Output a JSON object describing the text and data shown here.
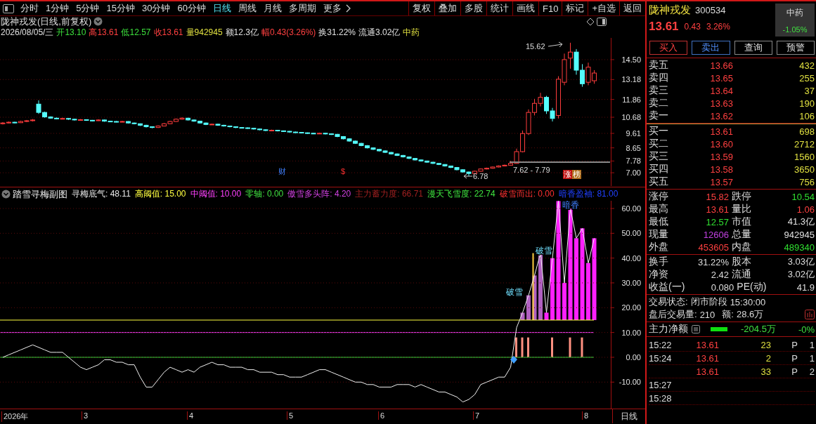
{
  "toolbar": {
    "periods": [
      {
        "label": "分时",
        "selected": false
      },
      {
        "label": "1分钟",
        "selected": false
      },
      {
        "label": "5分钟",
        "selected": false
      },
      {
        "label": "15分钟",
        "selected": false
      },
      {
        "label": "30分钟",
        "selected": false
      },
      {
        "label": "60分钟",
        "selected": false
      },
      {
        "label": "日线",
        "selected": true
      },
      {
        "label": "周线",
        "selected": false
      },
      {
        "label": "月线",
        "selected": false
      },
      {
        "label": "多周期",
        "selected": false
      },
      {
        "label": "更多",
        "selected": false
      }
    ],
    "tools": [
      "复权",
      "叠加",
      "多股",
      "统计",
      "画线",
      "F10",
      "标记",
      "+自选",
      "返回"
    ]
  },
  "main_chart": {
    "title": "陇神戎发(日线,前复权)",
    "info": [
      {
        "text": "2026/08/05/三",
        "color": "#e0e0e0"
      },
      {
        "text": "开13.10",
        "color": "#3ce03c"
      },
      {
        "text": "高13.61",
        "color": "#ff4040"
      },
      {
        "text": "低12.57",
        "color": "#3ce03c"
      },
      {
        "text": "收13.61",
        "color": "#ff4040"
      },
      {
        "text": "量942945",
        "color": "#e0e040"
      },
      {
        "text": "额12.3亿",
        "color": "#e0e0e0"
      },
      {
        "text": "幅0.43(3.26%)",
        "color": "#ff4040"
      },
      {
        "text": "换31.22%",
        "color": "#e0e0e0"
      },
      {
        "text": "流通3.02亿",
        "color": "#e0e0e0"
      },
      {
        "text": "中药",
        "color": "#e0e040"
      }
    ],
    "chart_data": {
      "type": "candlestick",
      "grid": true,
      "ylim": [
        6.12,
        15.94
      ],
      "yticks": [
        {
          "value": 14.5,
          "label": "14.50"
        },
        {
          "value": 13.18,
          "label": "13.18"
        },
        {
          "value": 11.86,
          "label": "11.86"
        },
        {
          "value": 10.68,
          "label": "10.68"
        },
        {
          "value": 9.61,
          "label": "9.61"
        },
        {
          "value": 8.65,
          "label": "8.65"
        },
        {
          "value": 7.78,
          "label": "7.78"
        },
        {
          "value": 7,
          "label": "7.00"
        }
      ],
      "ohlc": [
        [
          10.25,
          10.36,
          10.2,
          10.3
        ],
        [
          10.3,
          10.4,
          10.26,
          10.35
        ],
        [
          10.35,
          10.38,
          10.28,
          10.32
        ],
        [
          10.32,
          10.45,
          10.3,
          10.4
        ],
        [
          10.4,
          10.5,
          10.36,
          10.45
        ],
        [
          10.45,
          10.56,
          10.4,
          10.5
        ],
        [
          11.55,
          11.8,
          10.9,
          11.0
        ],
        [
          11.0,
          11.05,
          10.65,
          10.7
        ],
        [
          10.7,
          10.74,
          10.58,
          10.62
        ],
        [
          10.62,
          10.66,
          10.54,
          10.58
        ],
        [
          10.58,
          10.65,
          10.55,
          10.6
        ],
        [
          10.6,
          10.63,
          10.5,
          10.55
        ],
        [
          10.55,
          10.58,
          10.46,
          10.5
        ],
        [
          10.5,
          10.56,
          10.47,
          10.52
        ],
        [
          10.52,
          10.54,
          10.44,
          10.48
        ],
        [
          10.48,
          10.5,
          10.41,
          10.45
        ],
        [
          10.45,
          10.55,
          10.43,
          10.5
        ],
        [
          10.5,
          10.52,
          10.38,
          10.42
        ],
        [
          10.42,
          10.45,
          10.36,
          10.4
        ],
        [
          10.4,
          10.43,
          10.34,
          10.38
        ],
        [
          10.38,
          10.44,
          10.35,
          10.4
        ],
        [
          10.4,
          10.42,
          10.26,
          10.3
        ],
        [
          10.3,
          10.33,
          10.21,
          10.25
        ],
        [
          10.25,
          10.27,
          10.1,
          10.15
        ],
        [
          10.15,
          10.18,
          10.0,
          10.05
        ],
        [
          10.05,
          10.08,
          9.95,
          10.0
        ],
        [
          10.0,
          10.14,
          9.97,
          10.1
        ],
        [
          10.1,
          10.3,
          10.08,
          10.25
        ],
        [
          10.25,
          10.44,
          10.22,
          10.4
        ],
        [
          10.4,
          10.6,
          10.38,
          10.55
        ],
        [
          10.55,
          10.68,
          10.52,
          10.62
        ],
        [
          10.62,
          10.65,
          10.46,
          10.5
        ],
        [
          10.5,
          10.53,
          10.38,
          10.42
        ],
        [
          10.42,
          10.45,
          10.26,
          10.3
        ],
        [
          10.3,
          10.33,
          10.16,
          10.2
        ],
        [
          10.2,
          10.26,
          10.17,
          10.22
        ],
        [
          10.22,
          10.24,
          10.11,
          10.15
        ],
        [
          10.15,
          10.18,
          10.06,
          10.1
        ],
        [
          10.1,
          10.12,
          10.01,
          10.05
        ],
        [
          10.05,
          10.08,
          9.96,
          10.0
        ],
        [
          10.0,
          10.03,
          9.94,
          9.98
        ],
        [
          9.98,
          10.01,
          9.91,
          9.95
        ],
        [
          9.95,
          9.97,
          9.86,
          9.9
        ],
        [
          9.9,
          9.93,
          9.81,
          9.85
        ],
        [
          9.85,
          9.88,
          9.76,
          9.8
        ],
        [
          9.8,
          9.86,
          9.78,
          9.82
        ],
        [
          9.82,
          9.84,
          9.74,
          9.78
        ],
        [
          9.78,
          9.8,
          9.71,
          9.75
        ],
        [
          9.75,
          9.77,
          9.66,
          9.7
        ],
        [
          9.7,
          9.73,
          9.64,
          9.68
        ],
        [
          9.68,
          9.7,
          9.61,
          9.65
        ],
        [
          9.65,
          9.67,
          9.58,
          9.62
        ],
        [
          9.62,
          9.64,
          9.56,
          9.6
        ],
        [
          9.6,
          9.66,
          9.58,
          9.62
        ],
        [
          9.62,
          9.64,
          9.54,
          9.58
        ],
        [
          9.58,
          9.6,
          9.51,
          9.55
        ],
        [
          9.55,
          9.57,
          9.36,
          9.4
        ],
        [
          9.4,
          9.43,
          9.21,
          9.25
        ],
        [
          9.25,
          9.28,
          9.06,
          9.1
        ],
        [
          9.1,
          9.13,
          8.91,
          8.95
        ],
        [
          8.95,
          8.98,
          8.76,
          8.8
        ],
        [
          8.8,
          8.83,
          8.61,
          8.65
        ],
        [
          8.65,
          8.68,
          8.51,
          8.55
        ],
        [
          8.55,
          8.58,
          8.41,
          8.45
        ],
        [
          8.45,
          8.48,
          8.31,
          8.35
        ],
        [
          8.35,
          8.38,
          8.21,
          8.25
        ],
        [
          8.25,
          8.28,
          8.11,
          8.15
        ],
        [
          8.15,
          8.18,
          8.01,
          8.05
        ],
        [
          8.05,
          8.08,
          7.91,
          7.95
        ],
        [
          7.95,
          7.98,
          7.81,
          7.85
        ],
        [
          7.85,
          7.88,
          7.74,
          7.78
        ],
        [
          7.78,
          7.8,
          7.66,
          7.7
        ],
        [
          7.7,
          7.72,
          7.58,
          7.62
        ],
        [
          7.62,
          7.64,
          7.51,
          7.55
        ],
        [
          7.55,
          7.57,
          7.41,
          7.45
        ],
        [
          7.45,
          7.47,
          7.31,
          7.35
        ],
        [
          7.35,
          7.38,
          7.16,
          7.2
        ],
        [
          7.2,
          7.23,
          7.01,
          7.05
        ],
        [
          7.05,
          7.08,
          6.78,
          6.95
        ],
        [
          6.95,
          7.14,
          6.92,
          7.1
        ],
        [
          7.1,
          7.29,
          7.07,
          7.25
        ],
        [
          7.25,
          7.34,
          7.22,
          7.3
        ],
        [
          7.3,
          7.42,
          7.27,
          7.38
        ],
        [
          7.38,
          7.49,
          7.35,
          7.45
        ],
        [
          7.45,
          7.54,
          7.42,
          7.5
        ],
        [
          7.5,
          7.79,
          7.48,
          7.62
        ],
        [
          7.62,
          8.6,
          7.6,
          8.4
        ],
        [
          8.4,
          9.8,
          8.35,
          9.6
        ],
        [
          9.6,
          11.2,
          9.5,
          11.0
        ],
        [
          11.0,
          11.9,
          10.8,
          11.6
        ],
        [
          11.6,
          12.3,
          11.4,
          12.0
        ],
        [
          12.0,
          12.1,
          10.9,
          11.1
        ],
        [
          11.1,
          11.3,
          10.4,
          10.6
        ],
        [
          10.8,
          13.4,
          10.6,
          13.2
        ],
        [
          13.0,
          14.9,
          12.8,
          14.5
        ],
        [
          14.6,
          15.62,
          13.9,
          15.0
        ],
        [
          15.0,
          15.2,
          13.5,
          13.8
        ],
        [
          13.8,
          14.2,
          12.7,
          12.9
        ],
        [
          13.0,
          14.3,
          12.8,
          14.0
        ],
        [
          13.1,
          13.8,
          12.9,
          13.61
        ]
      ]
    },
    "high_note": "15.62",
    "low_note": "6.78",
    "range_note": "7.62 - 7.79",
    "markers": [
      {
        "text": "财",
        "kind": "news"
      },
      {
        "text": "$",
        "kind": "money"
      },
      {
        "text": "涨",
        "kind": "rise"
      },
      {
        "text": "榜",
        "kind": "list"
      }
    ]
  },
  "indicator": {
    "title": "踏雪寻梅副图",
    "values": [
      {
        "text": "寻梅底气: 48.11",
        "color": "#e8e8e8"
      },
      {
        "text": "高阈值: 15.00",
        "color": "#ffff40"
      },
      {
        "text": "中阈值: 10.00",
        "color": "#ff40ff"
      },
      {
        "text": "零轴: 0.00",
        "color": "#40e040"
      },
      {
        "text": "傲雪多头阵: 4.20",
        "color": "#d040e0"
      },
      {
        "text": "主力蓄力度: 66.71",
        "color": "#a02020"
      },
      {
        "text": "漫天飞雪度: 22.74",
        "color": "#40e840"
      },
      {
        "text": "破雪而出: 0.00",
        "color": "#ff3030"
      },
      {
        "text": "暗香盈袖: 81.00",
        "color": "#2040ff"
      }
    ],
    "chart_data": {
      "type": "line",
      "grid": true,
      "ylim": [
        -20.67,
        63.11
      ],
      "yticks": [
        {
          "value": 60,
          "label": "60.00"
        },
        {
          "value": 50,
          "label": "50.00"
        },
        {
          "value": 40,
          "label": "40.00"
        },
        {
          "value": 30,
          "label": "30.00"
        },
        {
          "value": 20,
          "label": "20.00"
        },
        {
          "value": 10,
          "label": "10.00"
        },
        {
          "value": 0,
          "label": "0.00"
        },
        {
          "value": -10,
          "label": "-10.00"
        }
      ],
      "series": [
        {
          "color": "#f0f0f0",
          "values": [
            0,
            1,
            2,
            3,
            4,
            5,
            4,
            3,
            2,
            2,
            2,
            0,
            -2,
            -4,
            -5,
            -4,
            -3,
            -1,
            -1,
            -2,
            -2,
            -3,
            -3,
            -8,
            -12,
            -12,
            -9,
            -6,
            -4,
            -5,
            -6,
            -5,
            -6,
            -4,
            -3,
            -2,
            -3,
            -3,
            -4,
            -4,
            -4,
            -5,
            -5,
            -6,
            -6,
            -6,
            -7,
            -7,
            -8,
            -8,
            -8,
            -7,
            -6,
            -5,
            -5,
            -6,
            -7,
            -8,
            -9,
            -10,
            -10,
            -11,
            -11,
            -12,
            -12,
            -12,
            -11,
            -11,
            -11,
            -12,
            -11,
            -12,
            -13,
            -14,
            -14,
            -15,
            -16,
            -18,
            -17,
            -15,
            -11,
            -10,
            -9,
            -8,
            -8,
            -4,
            12,
            18,
            25,
            33,
            42,
            18,
            40,
            63,
            30,
            60,
            48,
            52,
            38,
            48
          ]
        }
      ]
    },
    "labels": [
      {
        "text": "破雪",
        "kind": "early"
      },
      {
        "text": "破雪",
        "kind": "late"
      },
      {
        "text": "暗香",
        "kind": "top"
      }
    ]
  },
  "time_axis": {
    "labels": [
      "2026年",
      "3",
      "4",
      "5",
      "6",
      "7",
      "8"
    ],
    "period": "日线"
  },
  "quote": {
    "name": "陇神戎发",
    "code": "300534",
    "price": "13.61",
    "change": "0.43",
    "pct": "3.26%",
    "sector": {
      "name": "中药",
      "change": "-1.05%"
    }
  },
  "actions": [
    {
      "label": "买入",
      "kind": "buy"
    },
    {
      "label": "卖出",
      "kind": "sell"
    },
    {
      "label": "查询",
      "kind": "plain"
    },
    {
      "label": "预警",
      "kind": "plain"
    }
  ],
  "sells": [
    {
      "label": "卖五",
      "price": "13.66",
      "volume": "432"
    },
    {
      "label": "卖四",
      "price": "13.65",
      "volume": "255"
    },
    {
      "label": "卖三",
      "price": "13.64",
      "volume": "37"
    },
    {
      "label": "卖二",
      "price": "13.63",
      "volume": "190"
    },
    {
      "label": "卖一",
      "price": "13.62",
      "volume": "106"
    }
  ],
  "buys": [
    {
      "label": "买一",
      "price": "13.61",
      "volume": "698"
    },
    {
      "label": "买二",
      "price": "13.60",
      "volume": "2712"
    },
    {
      "label": "买三",
      "price": "13.59",
      "volume": "1560"
    },
    {
      "label": "买四",
      "price": "13.58",
      "volume": "3650"
    },
    {
      "label": "买五",
      "price": "13.57",
      "volume": "756"
    }
  ],
  "stats": [
    {
      "left": {
        "label": "涨停",
        "value": "15.82",
        "color": "#ff4040"
      },
      "right": {
        "label": "跌停",
        "value": "10.54",
        "color": "#30e030"
      }
    },
    {
      "left": {
        "label": "最高",
        "value": "13.61",
        "color": "#ff4040"
      },
      "right": {
        "label": "量比",
        "value": "1.06",
        "color": "#ff4040"
      }
    },
    {
      "left": {
        "label": "最低",
        "value": "12.57",
        "color": "#30e030"
      },
      "right": {
        "label": "市值",
        "value": "41.3亿",
        "color": "#e0e0e0"
      }
    },
    {
      "left": {
        "label": "现量",
        "value": "12606",
        "color": "#c040e0"
      },
      "right": {
        "label": "总量",
        "value": "942945",
        "color": "#e0e0e0"
      }
    },
    {
      "left": {
        "label": "外盘",
        "value": "453605",
        "color": "#ff4040"
      },
      "right": {
        "label": "内盘",
        "value": "489340",
        "color": "#30e030"
      }
    }
  ],
  "fundamentals": [
    {
      "left": {
        "label": "换手",
        "value": "31.22%"
      },
      "right": {
        "label": "股本",
        "value": "3.03亿"
      }
    },
    {
      "left": {
        "label": "净资",
        "value": "2.42"
      },
      "right": {
        "label": "流通",
        "value": "3.02亿"
      }
    },
    {
      "left": {
        "label": "收益(一)",
        "value": "0.080"
      },
      "right": {
        "label": "PE(动)",
        "value": "41.9"
      }
    }
  ],
  "status": {
    "label": "交易状态:",
    "value": "闭市阶段",
    "time": "15:30:00",
    "after_label": "盘后交易量:",
    "after_volume": "210",
    "amount_label": "额:",
    "amount": "28.6万"
  },
  "main_force": {
    "label": "主力净额",
    "value": "-204.5万",
    "pct": "-0%"
  },
  "trades": [
    {
      "time": "15:22",
      "price": "13.61",
      "volume": "23",
      "flag": "P",
      "count": "1"
    },
    {
      "time": "15:24",
      "price": "13.61",
      "volume": "2",
      "flag": "P",
      "count": "1"
    },
    {
      "price": "13.61",
      "volume": "33",
      "flag": "P",
      "count": "2"
    },
    {
      "time": "15:27"
    },
    {
      "time": "15:28"
    }
  ]
}
